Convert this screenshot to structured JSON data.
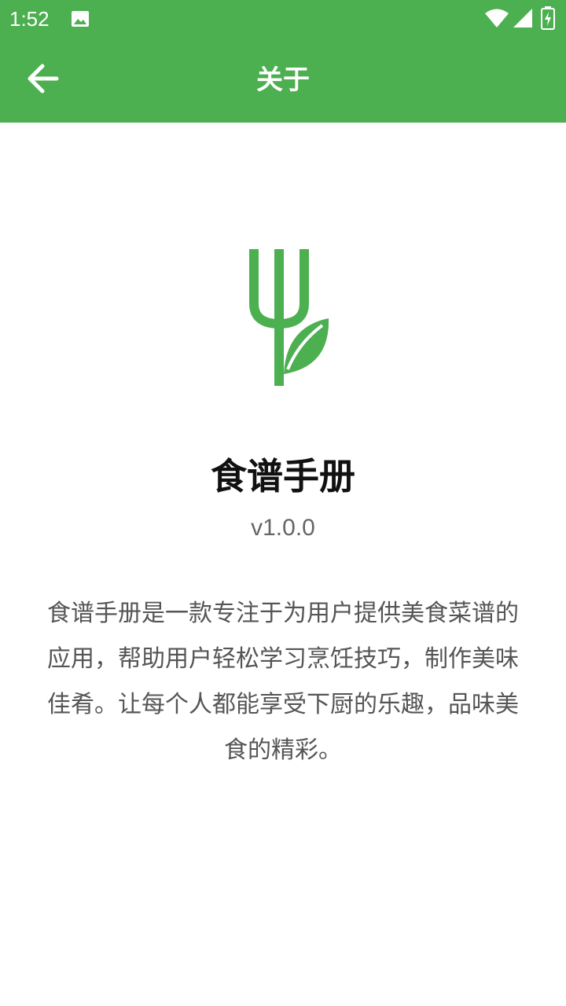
{
  "status_bar": {
    "time": "1:52",
    "icons": [
      "image-icon",
      "wifi-icon",
      "signal-icon",
      "battery-charging-icon"
    ]
  },
  "app_bar": {
    "title": "关于",
    "back_icon": "arrow-left-icon"
  },
  "about": {
    "logo_icon": "fork-leaf-icon",
    "app_name": "食谱手册",
    "version": "v1.0.0",
    "description": "食谱手册是一款专注于为用户提供美食菜谱的应用，帮助用户轻松学习烹饪技巧，制作美味佳肴。让每个人都能享受下厨的乐趣，品味美食的精彩。"
  },
  "colors": {
    "primary": "#4caf50",
    "text_dark": "#111111",
    "text_muted": "#666666"
  }
}
